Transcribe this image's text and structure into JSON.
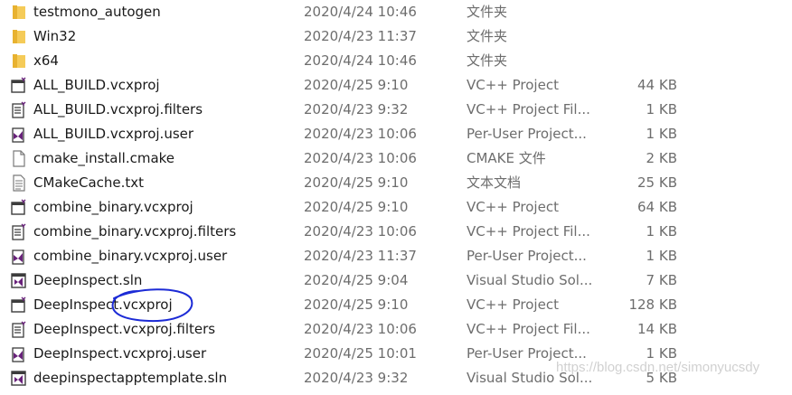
{
  "files": [
    {
      "name": "testmono_autogen",
      "date": "2020/4/24 10:46",
      "type": "文件夹",
      "size": "",
      "icon": "folder-icon"
    },
    {
      "name": "Win32",
      "date": "2020/4/23 11:37",
      "type": "文件夹",
      "size": "",
      "icon": "folder-icon"
    },
    {
      "name": "x64",
      "date": "2020/4/24 10:46",
      "type": "文件夹",
      "size": "",
      "icon": "folder-icon"
    },
    {
      "name": "ALL_BUILD.vcxproj",
      "date": "2020/4/25 9:10",
      "type": "VC++ Project",
      "size": "44 KB",
      "icon": "vcxproj-icon"
    },
    {
      "name": "ALL_BUILD.vcxproj.filters",
      "date": "2020/4/23 9:32",
      "type": "VC++ Project Fil...",
      "size": "1 KB",
      "icon": "vcxproj-filters-icon"
    },
    {
      "name": "ALL_BUILD.vcxproj.user",
      "date": "2020/4/23 10:06",
      "type": "Per-User Project...",
      "size": "1 KB",
      "icon": "vcxproj-user-icon"
    },
    {
      "name": "cmake_install.cmake",
      "date": "2020/4/23 10:06",
      "type": "CMAKE 文件",
      "size": "2 KB",
      "icon": "blank-file-icon"
    },
    {
      "name": "CMakeCache.txt",
      "date": "2020/4/25 9:10",
      "type": "文本文档",
      "size": "25 KB",
      "icon": "text-file-icon"
    },
    {
      "name": "combine_binary.vcxproj",
      "date": "2020/4/25 9:10",
      "type": "VC++ Project",
      "size": "64 KB",
      "icon": "vcxproj-icon"
    },
    {
      "name": "combine_binary.vcxproj.filters",
      "date": "2020/4/23 10:06",
      "type": "VC++ Project Fil...",
      "size": "1 KB",
      "icon": "vcxproj-filters-icon"
    },
    {
      "name": "combine_binary.vcxproj.user",
      "date": "2020/4/23 11:37",
      "type": "Per-User Project...",
      "size": "1 KB",
      "icon": "vcxproj-user-icon"
    },
    {
      "name": "DeepInspect.sln",
      "date": "2020/4/25 9:04",
      "type": "Visual Studio Sol...",
      "size": "7 KB",
      "icon": "sln-icon"
    },
    {
      "name": "DeepInspect.vcxproj",
      "date": "2020/4/25 9:10",
      "type": "VC++ Project",
      "size": "128 KB",
      "icon": "vcxproj-icon"
    },
    {
      "name": "DeepInspect.vcxproj.filters",
      "date": "2020/4/23 10:06",
      "type": "VC++ Project Fil...",
      "size": "14 KB",
      "icon": "vcxproj-filters-icon"
    },
    {
      "name": "DeepInspect.vcxproj.user",
      "date": "2020/4/25 10:01",
      "type": "Per-User Project...",
      "size": "1 KB",
      "icon": "vcxproj-user-icon"
    },
    {
      "name": "deepinspectapptemplate.sln",
      "date": "2020/4/23 9:32",
      "type": "Visual Studio Sol...",
      "size": "5 KB",
      "icon": "sln-icon"
    }
  ],
  "watermark": "https://blog.csdn.net/simonyucsdy",
  "colors": {
    "folder": "#e8b230",
    "vs_purple": "#68217a",
    "annotation": "#1c2bd6"
  }
}
